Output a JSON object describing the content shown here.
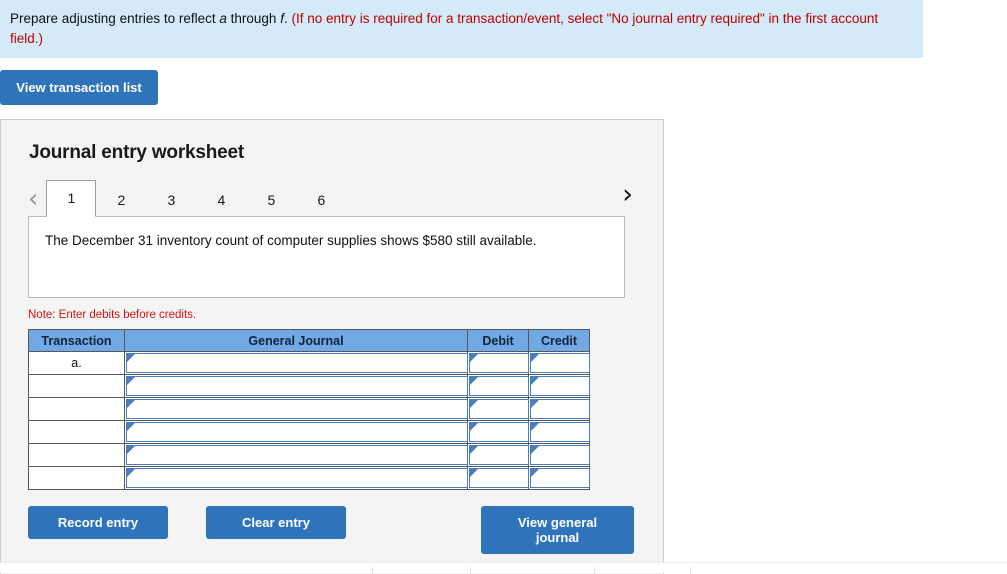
{
  "banner": {
    "lead": "Prepare adjusting entries to reflect ",
    "em1": "a",
    "mid": " through ",
    "em2": "f",
    "period": ".",
    "red": " (If no entry is required for a transaction/event, select \"No journal entry required\" in the first account field.)"
  },
  "toolbar": {
    "view_transaction_list_label": "View transaction list"
  },
  "panel": {
    "title": "Journal entry worksheet",
    "prev_icon": "chevron-left-icon",
    "next_icon": "chevron-right-icon",
    "prev_glyph": "‹",
    "next_glyph": "›",
    "tabs": [
      {
        "label": "1",
        "active": true
      },
      {
        "label": "2",
        "active": false
      },
      {
        "label": "3",
        "active": false
      },
      {
        "label": "4",
        "active": false
      },
      {
        "label": "5",
        "active": false
      },
      {
        "label": "6",
        "active": false
      }
    ],
    "scenario_text": "The December 31 inventory count of computer supplies shows $580 still available.",
    "note": "Note: Enter debits before credits."
  },
  "table": {
    "headers": [
      "Transaction",
      "General Journal",
      "Debit",
      "Credit"
    ],
    "rows": [
      {
        "transaction": "a.",
        "general_journal": "",
        "debit": "",
        "credit": ""
      },
      {
        "transaction": "",
        "general_journal": "",
        "debit": "",
        "credit": ""
      },
      {
        "transaction": "",
        "general_journal": "",
        "debit": "",
        "credit": ""
      },
      {
        "transaction": "",
        "general_journal": "",
        "debit": "",
        "credit": ""
      },
      {
        "transaction": "",
        "general_journal": "",
        "debit": "",
        "credit": ""
      },
      {
        "transaction": "",
        "general_journal": "",
        "debit": "",
        "credit": ""
      }
    ]
  },
  "footer": {
    "record_label": "Record entry",
    "clear_label": "Clear entry",
    "view_general_journal_label": "View general journal"
  },
  "colors": {
    "banner_bg": "#d4eaf8",
    "banner_red": "#c00000",
    "button_blue": "#2f74bb",
    "table_header_blue": "#70a9e3",
    "field_border_blue": "#4a7ebb",
    "note_red": "#d01414",
    "panel_bg": "#f4f4f4"
  }
}
